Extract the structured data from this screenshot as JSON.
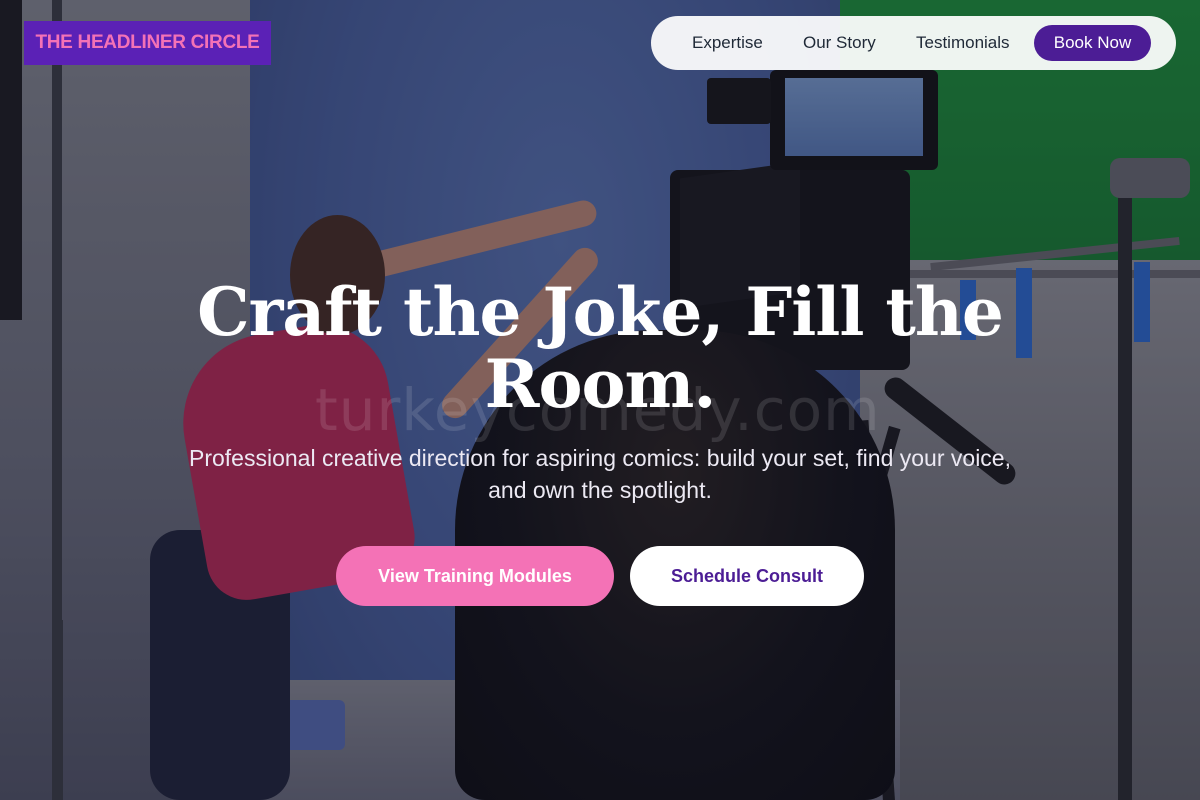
{
  "brand": {
    "name": "THE HEADLINER CIRCLE",
    "bg_color": "#5b21b6",
    "text_color": "#f472b6"
  },
  "nav": {
    "items": [
      {
        "label": "Expertise"
      },
      {
        "label": "Our Story"
      },
      {
        "label": "Testimonials"
      }
    ],
    "cta_label": "Book Now",
    "cta_color": "#4c1d95"
  },
  "hero": {
    "title": "Craft the Joke, Fill the Room.",
    "subtitle": "Professional creative direction for aspiring comics: build your set, find your voice, and own the spotlight.",
    "primary_button": "View Training Modules",
    "secondary_button": "Schedule Consult",
    "watermark": "turkeycomedy.com",
    "background_image": "film-studio-camera-crew-photo"
  },
  "colors": {
    "accent_pink": "#f472b6",
    "accent_purple": "#4c1d95"
  }
}
